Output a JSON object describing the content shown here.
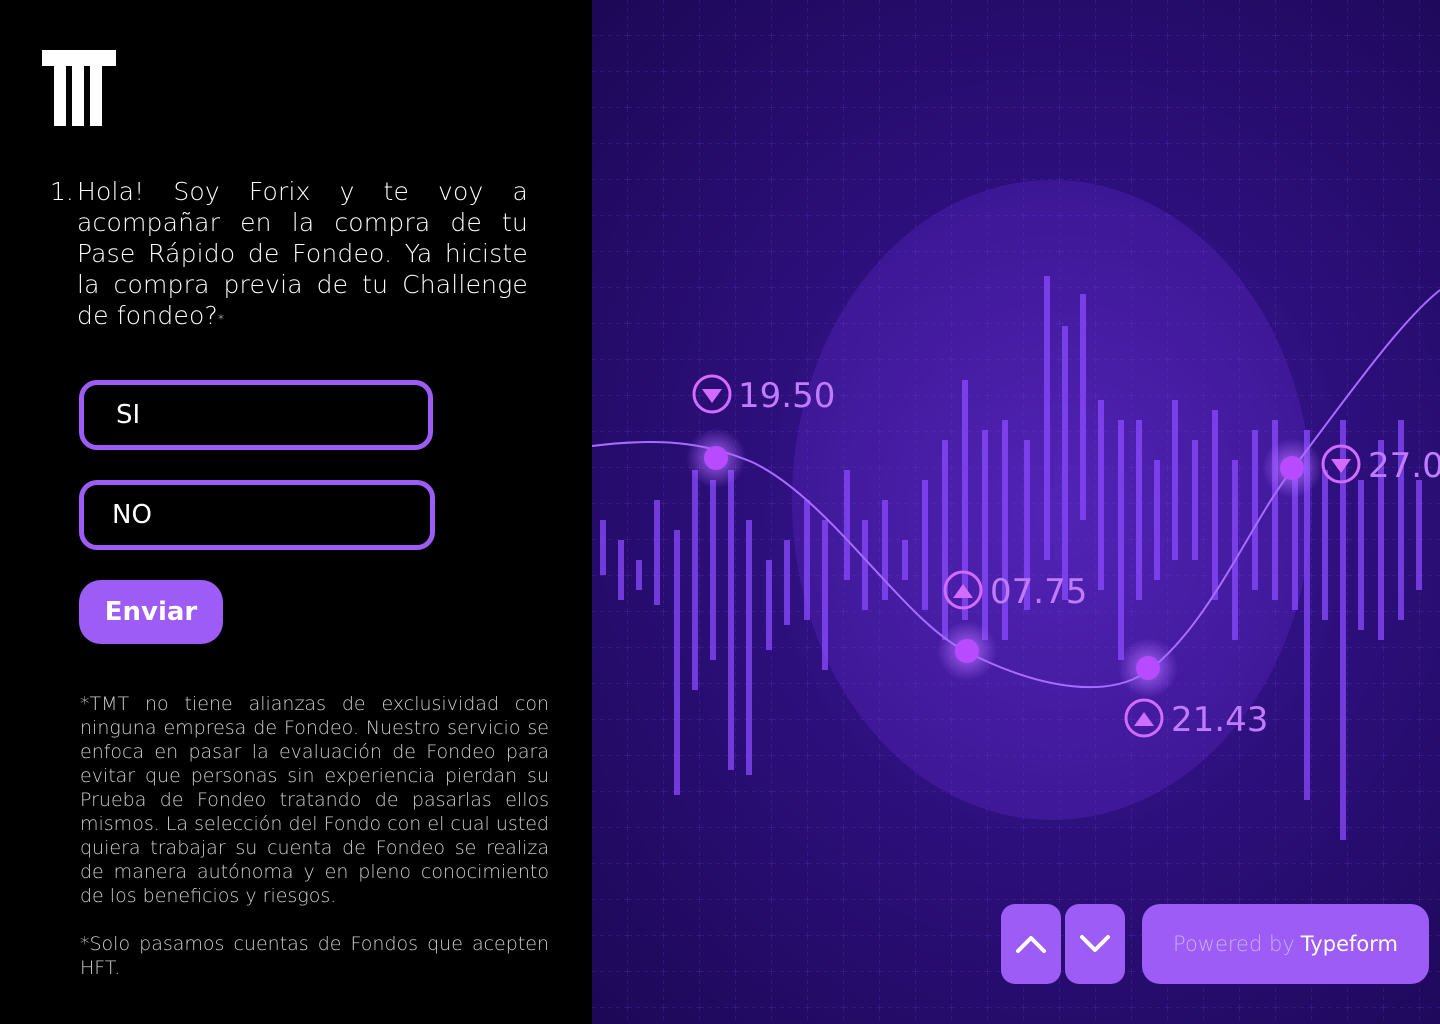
{
  "question": {
    "number": "1.",
    "text": "Hola! Soy Forix y te voy a acompañar en la compra de tu Pase Rápido de Fondeo. Ya hiciste la compra previa de tu Challenge de fondeo?",
    "required_mark": "*"
  },
  "choices": [
    {
      "label": "SI"
    },
    {
      "label": "NO"
    }
  ],
  "submit_label": "Enviar",
  "disclaimer": [
    "*TMT no tiene alianzas de exclusividad con ninguna empresa de Fondeo. Nuestro servicio se enfoca en pasar la evaluación de Fondeo para evitar que personas sin experiencia pierdan su Prueba de Fondeo tratando de pasarlas ellos mismos. La selección del Fondo con el cual usted quiera trabajar su cuenta de Fondeo se realiza de manera autónoma y en pleno conocimiento de los beneficios y riesgos.",
    "*Solo pasamos cuentas de Fondos que acepten HFT."
  ],
  "background_labels": [
    "19.50",
    "07.75",
    "21.43",
    "27.0"
  ],
  "footer": {
    "powered_prefix": "Powered by",
    "powered_brand": "Typeform"
  },
  "colors": {
    "accent": "#9c5cf5",
    "background": "#000000",
    "bg_right": "#2d0f7c"
  }
}
